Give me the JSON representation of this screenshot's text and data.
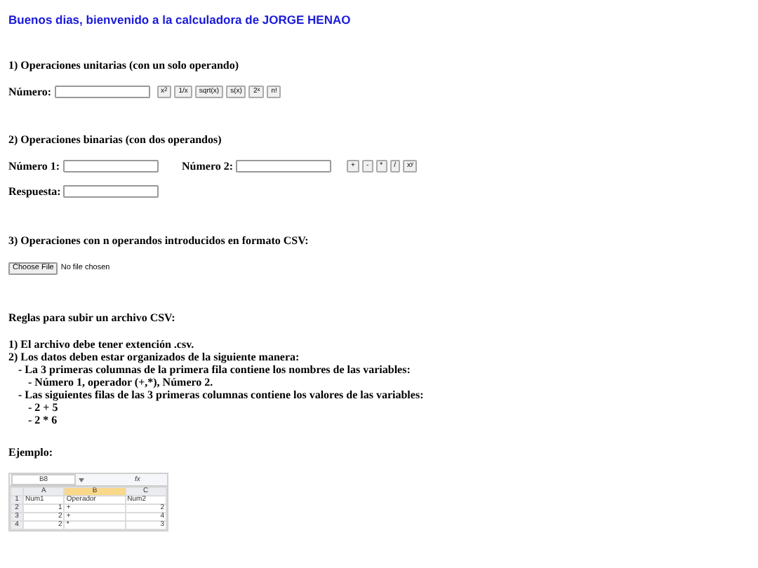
{
  "title": "Buenos dias, bienvenido a la calculadora de JORGE HENAO",
  "unary": {
    "heading": "1) Operaciones unitarias (con un solo operando)",
    "label": "Número:",
    "buttons": [
      "x$^{2}$",
      "1/x",
      "sqrt(x)",
      "s(x)",
      "2$^{x}$",
      "n!"
    ]
  },
  "binary": {
    "heading": "2) Operaciones binarias (con dos operandos)",
    "label_1": "Número 1:",
    "label_2": "Número 2:",
    "buttons": [
      "+",
      "-",
      "*",
      "/",
      "x$^{y}$"
    ],
    "answer_label": "Respuesta:"
  },
  "csv": {
    "heading": "3) Operaciones con n operandos introducidos en formato CSV:",
    "file_button": "Choose File",
    "file_status": "No file chosen"
  },
  "rules": {
    "heading": "Reglas para subir un archivo CSV:",
    "items": [
      {
        "text": "1) El archivo debe tener extención .csv."
      },
      {
        "text": "2) Los datos deben estar organizados de la siguiente manera:",
        "children": [
          {
            "text": "- La 3 primeras columnas de la primera fila contiene los nombres de las variables:",
            "children": [
              {
                "text": "- Número 1, operador (+,*), Número 2."
              }
            ]
          },
          {
            "text": "- Las siguientes filas de las 3 primeras columnas contiene los valores de las variables:",
            "children": [
              {
                "text": "- 2 + 5"
              },
              {
                "text": "- 2 * 6"
              }
            ]
          }
        ]
      }
    ]
  },
  "example": {
    "heading": "Ejemplo:",
    "sheet": {
      "name_box": "B8",
      "function_label": "fx",
      "columns": [
        {
          "label": "A",
          "selected": false
        },
        {
          "label": "B",
          "selected": true
        },
        {
          "label": "C",
          "selected": false
        }
      ],
      "rows": [
        {
          "number": "1",
          "kind": "labels",
          "cells": [
            "Num1",
            "Operador",
            "Num2"
          ]
        },
        {
          "number": "2",
          "kind": "values",
          "cells": [
            "1",
            "+",
            "2"
          ]
        },
        {
          "number": "3",
          "kind": "values",
          "cells": [
            "2",
            "+",
            "4"
          ]
        },
        {
          "number": "4",
          "kind": "values",
          "cells": [
            "2",
            "*",
            "3"
          ]
        }
      ]
    }
  }
}
